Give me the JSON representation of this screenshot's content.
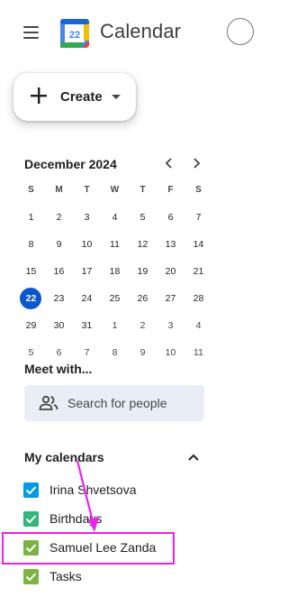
{
  "header": {
    "app_title": "Calendar",
    "logo_day": "22"
  },
  "create_button": {
    "label": "Create"
  },
  "mini_calendar": {
    "month_label": "December 2024",
    "weekdays": [
      "S",
      "M",
      "T",
      "W",
      "T",
      "F",
      "S"
    ],
    "weeks": [
      [
        "1",
        "2",
        "3",
        "4",
        "5",
        "6",
        "7"
      ],
      [
        "8",
        "9",
        "10",
        "11",
        "12",
        "13",
        "14"
      ],
      [
        "15",
        "16",
        "17",
        "18",
        "19",
        "20",
        "21"
      ],
      [
        "22",
        "23",
        "24",
        "25",
        "26",
        "27",
        "28"
      ],
      [
        "29",
        "30",
        "31",
        "1",
        "2",
        "3",
        "4"
      ],
      [
        "5",
        "6",
        "7",
        "8",
        "9",
        "10",
        "11"
      ]
    ],
    "today": "22"
  },
  "meet_with": {
    "title": "Meet with...",
    "search_placeholder": "Search for people"
  },
  "my_calendars": {
    "title": "My calendars",
    "items": [
      {
        "label": "Irina Shvetsova",
        "color": "#039be5"
      },
      {
        "label": "Birthdays",
        "color": "#33b679"
      },
      {
        "label": "Samuel Lee Zanda",
        "color": "#7cb342"
      },
      {
        "label": "Tasks",
        "color": "#7cb342"
      }
    ]
  },
  "annotation_color": "#f01ef0"
}
